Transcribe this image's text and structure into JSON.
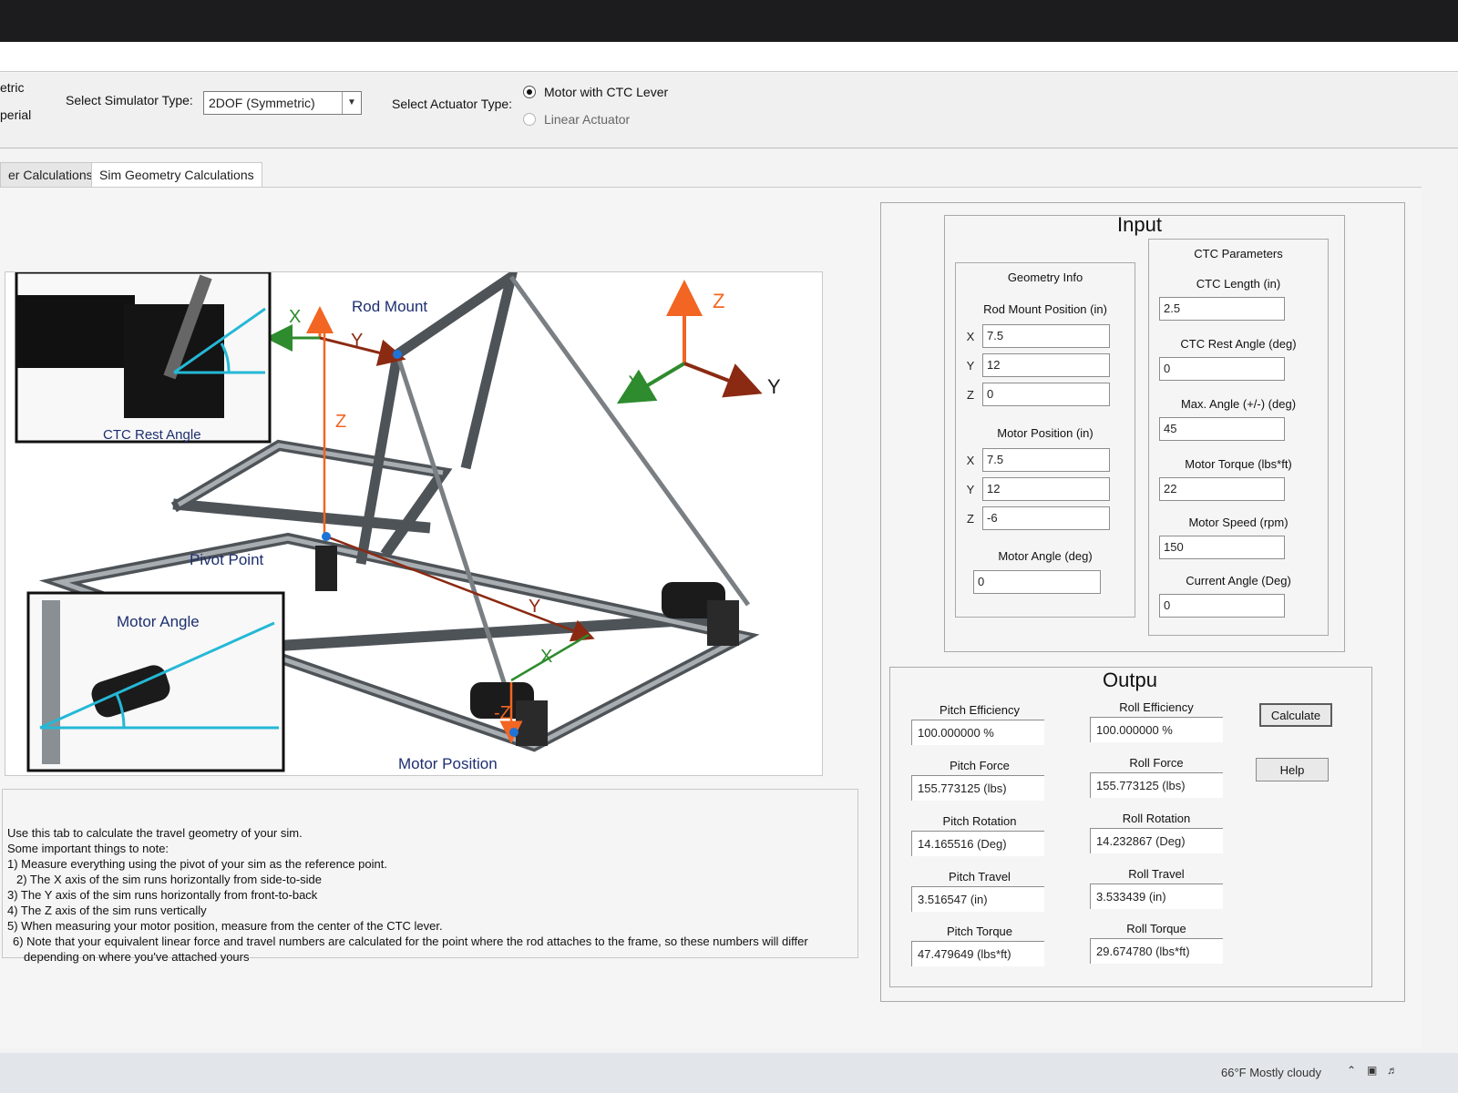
{
  "toolbar": {
    "units_metric": "etric",
    "units_imperial": "perial",
    "simulator_label": "Select Simulator Type:",
    "simulator_value": "2DOF (Symmetric)",
    "actuator_label": "Select Actuator Type:",
    "actuator_options": [
      "Motor with CTC Lever",
      "Linear Actuator"
    ]
  },
  "tabs": [
    "er Calculations",
    "Sim Geometry Calculations"
  ],
  "diagram": {
    "rod_mount": "Rod Mount",
    "ctc_rest_angle": "CTC Rest Angle",
    "pivot_point": "Pivot Point",
    "motor_angle": "Motor Angle",
    "motor_position": "Motor Position",
    "axis_x": "X",
    "axis_y": "Y",
    "axis_z": "Z",
    "axis_neg_z": "-Z"
  },
  "notes": [
    "Use this tab to calculate the travel geometry of your sim.",
    "Some important things to note:",
    "1) Measure everything using the pivot of your sim as the reference point.",
    "2) The X axis of the sim runs horizontally from side-to-side",
    "3) The Y axis of the sim runs horizontally from front-to-back",
    "4) The Z axis of the sim runs vertically",
    "5) When measuring your motor position, measure from the center of the CTC lever.",
    "6) Note that your equivalent linear force and travel numbers are calculated for the point where the rod attaches to the frame, so these numbers will differ",
    "depending on where you've attached yours"
  ],
  "input": {
    "title": "Input",
    "geometry_title": "Geometry Info",
    "rod_mount_label": "Rod Mount Position (in)",
    "rod_mount": {
      "x": "7.5",
      "y": "12",
      "z": "0"
    },
    "motor_pos_label": "Motor Position (in)",
    "motor_pos": {
      "x": "7.5",
      "y": "12",
      "z": "-6"
    },
    "motor_angle_label": "Motor Angle (deg)",
    "motor_angle": "0",
    "axis_labels": {
      "x": "X",
      "y": "Y",
      "z": "Z"
    },
    "ctc_title": "CTC Parameters",
    "ctc_length_label": "CTC Length (in)",
    "ctc_length": "2.5",
    "ctc_rest_label": "CTC Rest Angle (deg)",
    "ctc_rest": "0",
    "max_angle_label": "Max. Angle (+/-) (deg)",
    "max_angle": "45",
    "motor_torque_label": "Motor Torque (lbs*ft)",
    "motor_torque": "22",
    "motor_speed_label": "Motor Speed (rpm)",
    "motor_speed": "150",
    "current_angle_label": "Current Angle (Deg)",
    "current_angle": "0"
  },
  "output": {
    "title": "Outpu",
    "pitch_eff_label": "Pitch Efficiency",
    "pitch_eff": "100.000000   %",
    "roll_eff_label": "Roll Efficiency",
    "roll_eff": "100.000000   %",
    "pitch_force_label": "Pitch Force",
    "pitch_force": "155.773125   (lbs)",
    "roll_force_label": "Roll Force",
    "roll_force": "155.773125   (lbs)",
    "pitch_rot_label": "Pitch Rotation",
    "pitch_rot": "14.165516   (Deg)",
    "roll_rot_label": "Roll Rotation",
    "roll_rot": "14.232867   (Deg)",
    "pitch_travel_label": "Pitch Travel",
    "pitch_travel": "3.516547   (in)",
    "roll_travel_label": "Roll Travel",
    "roll_travel": "3.533439   (in)",
    "pitch_torque_label": "Pitch Torque",
    "pitch_torque": "47.479649   (lbs*ft)",
    "roll_torque_label": "Roll Torque",
    "roll_torque": "29.674780   (lbs*ft)",
    "calculate": "Calculate",
    "help": "Help"
  },
  "taskbar": {
    "weather": "66°F  Mostly cloudy"
  },
  "colors": {
    "axis_orange": "#f26522",
    "axis_green": "#2e8b2e",
    "axis_red": "#8b2a12",
    "angle_cyan": "#25b8d6",
    "label_navy": "#1d2f6f"
  }
}
